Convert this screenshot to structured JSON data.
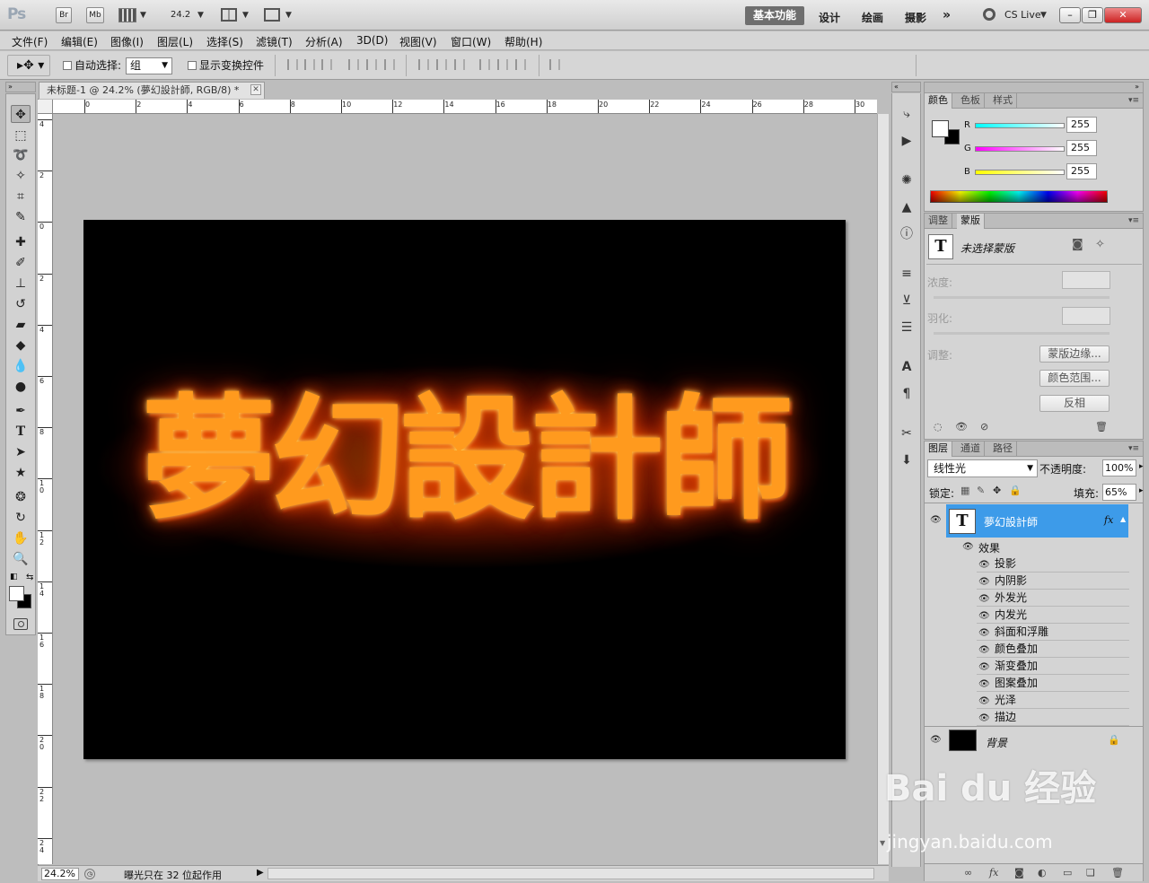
{
  "app": {
    "logo": "Ps",
    "bridge_label": "Br",
    "minibridge_label": "Mb",
    "zoom_value": "24.2",
    "workspaces": [
      "基本功能",
      "设计",
      "绘画",
      "摄影"
    ],
    "more_label": "»",
    "cslive_label": "CS Live"
  },
  "menu": [
    "文件(F)",
    "编辑(E)",
    "图像(I)",
    "图层(L)",
    "选择(S)",
    "滤镜(T)",
    "分析(A)",
    "3D(D)",
    "视图(V)",
    "窗口(W)",
    "帮助(H)"
  ],
  "options": {
    "auto_select_label": "自动选择:",
    "auto_select_value": "组",
    "show_transform_label": "显示变换控件"
  },
  "document": {
    "tab_title": "未标题-1 @ 24.2% (夢幻設計師, RGB/8) *",
    "canvas_text": "夢幻設計師",
    "ruler_h": [
      "0",
      "2",
      "4",
      "6",
      "8",
      "10",
      "12",
      "14",
      "16",
      "18",
      "20",
      "22",
      "24",
      "26",
      "28",
      "30"
    ],
    "ruler_v": [
      "4",
      "2",
      "0",
      "2",
      "4",
      "6",
      "8",
      "1 0",
      "1 2",
      "1 4",
      "1 6",
      "1 8",
      "2 0",
      "2 2",
      "2 4"
    ],
    "status_zoom": "24.2%",
    "status_text": "曝光只在 32 位起作用"
  },
  "color_panel": {
    "tabs": [
      "颜色",
      "色板",
      "样式"
    ],
    "r_label": "R",
    "g_label": "G",
    "b_label": "B",
    "r": "255",
    "g": "255",
    "b": "255",
    "colors": {
      "r_track": "#00c8d8",
      "g_track": "#e020e0",
      "b_track": "#e8e800"
    }
  },
  "masks_panel": {
    "tabs": [
      "调整",
      "蒙版"
    ],
    "title": "未选择蒙版",
    "density_label": "浓度:",
    "feather_label": "羽化:",
    "refine_label": "调整:",
    "btn_mask_edge": "蒙版边缘...",
    "btn_color_range": "颜色范围...",
    "btn_invert": "反相"
  },
  "layers_panel": {
    "tabs": [
      "图层",
      "通道",
      "路径"
    ],
    "blend_mode": "线性光",
    "opacity_label": "不透明度:",
    "opacity": "100%",
    "lock_label": "锁定:",
    "fill_label": "填充:",
    "fill": "65%",
    "text_layer_name": "夢幻設計師",
    "fx_badge": "fx",
    "effects_label": "效果",
    "effects": [
      "投影",
      "内阴影",
      "外发光",
      "内发光",
      "斜面和浮雕",
      "颜色叠加",
      "渐变叠加",
      "图案叠加",
      "光泽",
      "描边"
    ],
    "background_name": "背景"
  },
  "watermark": {
    "brand": "Bai du 经验",
    "url": "jingyan.baidu.com"
  },
  "colors": {
    "layer_selected": "#3d9be9",
    "fire": "#ff9a1e"
  }
}
